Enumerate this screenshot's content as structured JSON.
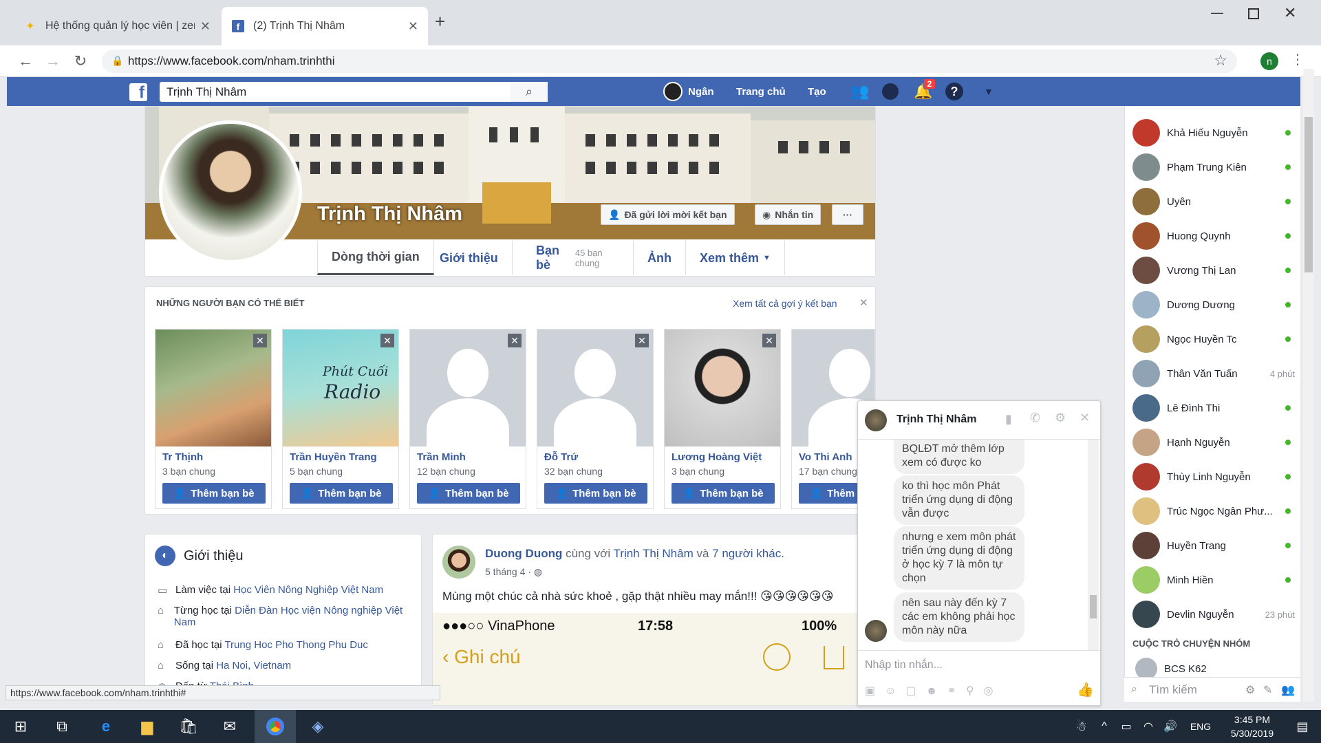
{
  "browser": {
    "tabs": [
      {
        "title": "Hệ thống quản lý học viên | zent",
        "active": false,
        "icon": "handshake-icon"
      },
      {
        "title": "(2) Trịnh Thị Nhâm",
        "active": true,
        "icon": "facebook-icon"
      }
    ],
    "url": "https://www.facebook.com/nham.trinhthi",
    "avatar_letter": "n",
    "status_url": "https://www.facebook.com/nham.trinhthi#"
  },
  "fb": {
    "search_value": "Trịnh Thị Nhâm",
    "user_name": "Ngân",
    "home": "Trang chủ",
    "create": "Tạo",
    "notif_count": "2",
    "accent": "#4267b2"
  },
  "profile": {
    "name": "Trịnh Thị Nhâm",
    "friend_request_btn": "Đã gửi lời mời kết bạn",
    "message_btn": "Nhắn tin",
    "more_btn": "···",
    "tabs": {
      "timeline": "Dòng thời gian",
      "about": "Giới thiệu",
      "friends": "Bạn bè",
      "mutual": "45 bạn chung",
      "photos": "Ảnh",
      "more": "Xem thêm"
    }
  },
  "pymk": {
    "title": "NHỮNG NGƯỜI BẠN CÓ THỂ BIẾT",
    "see_all": "Xem tất cả gợi ý kết bạn",
    "add_label": "Thêm bạn bè",
    "people": [
      {
        "name": "Tr Thịnh",
        "mutual": "3 bạn chung"
      },
      {
        "name": "Trần Huyền Trang",
        "mutual": "5 bạn chung"
      },
      {
        "name": "Trần Minh",
        "mutual": "12 bạn chung"
      },
      {
        "name": "Đỗ Trứ",
        "mutual": "32 bạn chung"
      },
      {
        "name": "Lương Hoàng Việt",
        "mutual": "3 bạn chung"
      },
      {
        "name": "Vo Thi Anh",
        "mutual": "17 bạn chung"
      }
    ],
    "radio_text_1": "Phút Cuối",
    "radio_text_2": "Radio"
  },
  "intro": {
    "title": "Giới thiệu",
    "rows": [
      {
        "prefix": "Làm việc tại ",
        "link": "Học Viên Nông Nghiệp Việt Nam"
      },
      {
        "prefix": "Từng học tại ",
        "link": "Diễn Đàn Học viện Nông nghiệp Việt Nam"
      },
      {
        "prefix": "Đã học tại ",
        "link": "Trung Hoc Pho Thong Phu Duc"
      },
      {
        "prefix": "Sống tại ",
        "link": "Ha Noi, Vietnam"
      },
      {
        "prefix": "Đến từ ",
        "link": "Thái Bình"
      }
    ]
  },
  "post": {
    "author": "Duong Duong",
    "with_text": "cùng với",
    "tagged": "Trịnh Thị Nhâm",
    "and_text": "và",
    "others": "7 người khác.",
    "time": "5 tháng 4",
    "text": "Mùng một chúc cả nhà sức khoẻ , gặp thật nhiều may mắn!!! 😘😘😘😘😘😘",
    "phone_carrier": "●●●○○ VinaPhone",
    "phone_time": "17:58",
    "phone_battery": "100%",
    "notes_label": "Ghi chú"
  },
  "chat": {
    "name": "Trịnh Thị Nhâm",
    "messages": [
      "BQLĐT mở thêm lớp xem có được ko",
      "ko thì học môn Phát triển ứng dụng di động vẫn được",
      "nhưng e xem môn phát triển ứng dụng di động ở học kỳ 7 là môn tự chọn",
      "nên sau này đến kỳ 7 các em không phải học môn này nữa"
    ],
    "placeholder": "Nhập tin nhắn..."
  },
  "sidebar": {
    "contacts": [
      {
        "name": "Khả Hiếu Nguyễn",
        "status": "online",
        "color": "#c0392b"
      },
      {
        "name": "Phạm Trung Kiên",
        "status": "online",
        "color": "#7f8c8d"
      },
      {
        "name": "Uyên",
        "status": "online",
        "color": "#8e6e3b"
      },
      {
        "name": "Huong Quynh",
        "status": "online",
        "color": "#a0522d"
      },
      {
        "name": "Vương Thị Lan",
        "status": "online",
        "color": "#6d4c41"
      },
      {
        "name": "Dương Dương",
        "status": "online",
        "color": "#9db4c8"
      },
      {
        "name": "Ngọc Huyền Tc",
        "status": "online",
        "color": "#b5a060"
      },
      {
        "name": "Thân Văn Tuấn",
        "status": "4 phút",
        "color": "#8fa3b5"
      },
      {
        "name": "Lê Đình Thi",
        "status": "online",
        "color": "#4a6a8a"
      },
      {
        "name": "Hạnh Nguyễn",
        "status": "online",
        "color": "#c4a484"
      },
      {
        "name": "Thùy Linh Nguyễn",
        "status": "online",
        "color": "#b03a2e"
      },
      {
        "name": "Trúc Ngọc Ngân Phư...",
        "status": "online",
        "color": "#e0c080"
      },
      {
        "name": "Huyền Trang",
        "status": "online",
        "color": "#5d4037"
      },
      {
        "name": "Minh Hiền",
        "status": "online",
        "color": "#9ccc65"
      },
      {
        "name": "Devlin Nguyễn",
        "status": "23 phút",
        "color": "#37474f"
      }
    ],
    "group_title": "CUỘC TRÒ CHUYỆN NHÓM",
    "group_name": "BCS K62",
    "search_placeholder": "Tìm kiếm"
  },
  "taskbar": {
    "time": "3:45 PM",
    "date": "5/30/2019",
    "lang": "ENG"
  }
}
